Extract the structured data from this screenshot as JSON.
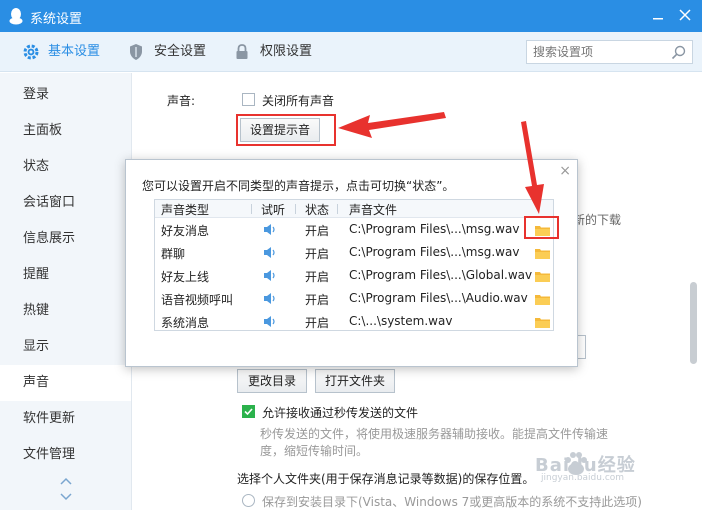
{
  "window": {
    "title": "系统设置",
    "min_icon": "minimize-icon",
    "close_icon": "close-icon"
  },
  "tabs": [
    {
      "label": "基本设置",
      "icon": "gear-icon",
      "active": true
    },
    {
      "label": "安全设置",
      "icon": "shield-icon",
      "active": false
    },
    {
      "label": "权限设置",
      "icon": "lock-icon",
      "active": false
    }
  ],
  "search": {
    "placeholder": "搜索设置项"
  },
  "sidebar": {
    "items": [
      {
        "label": "登录"
      },
      {
        "label": "主面板"
      },
      {
        "label": "状态"
      },
      {
        "label": "会话窗口"
      },
      {
        "label": "信息展示"
      },
      {
        "label": "提醒"
      },
      {
        "label": "热键"
      },
      {
        "label": "显示"
      },
      {
        "label": "声音",
        "active": true
      },
      {
        "label": "软件更新"
      },
      {
        "label": "文件管理"
      }
    ]
  },
  "sound": {
    "label": "声音:",
    "mute_all": "关闭所有声音",
    "set_button": "设置提示音"
  },
  "background": {
    "partial_text": "新的下载",
    "change_dir": "更改目录",
    "open_folder": "打开文件夹",
    "allow_receive": "允许接收通过秒传发送的文件",
    "allow_desc_1": "秒传发送的文件，将使用极速服务器辅助接收。能提高文件传输速",
    "allow_desc_2": "度，缩短传输时间。",
    "personal_folder": "选择个人文件夹(用于保存消息记录等数据)的保存位置。",
    "save_install_dir": "保存到安装目录下(Vista、Windows 7或更高版本的系统不支持此选项)"
  },
  "dialog": {
    "hint": "您可以设置开启不同类型的声音提示，点击可切换“状态”。",
    "close_glyph": "×",
    "columns": [
      "声音类型",
      "试听",
      "状态",
      "声音文件"
    ],
    "rows": [
      {
        "type": "好友消息",
        "status": "开启",
        "file": "C:\\Program Files\\...\\msg.wav"
      },
      {
        "type": "群聊",
        "status": "开启",
        "file": "C:\\Program Files\\...\\msg.wav"
      },
      {
        "type": "好友上线",
        "status": "开启",
        "file": "C:\\Program Files\\...\\Global.wav"
      },
      {
        "type": "语音视频呼叫",
        "status": "开启",
        "file": "C:\\Program Files\\...\\Audio.wav"
      },
      {
        "type": "系统消息",
        "status": "开启",
        "file": "C:\\...\\system.wav"
      }
    ]
  },
  "watermark": {
    "text": "Baidu经验",
    "sub": "jingyan.baidu.com"
  },
  "colors": {
    "accent": "#2a8ee4",
    "annotation": "#e8322e",
    "check": "#2bb24c",
    "folder": "#f5b93a"
  }
}
